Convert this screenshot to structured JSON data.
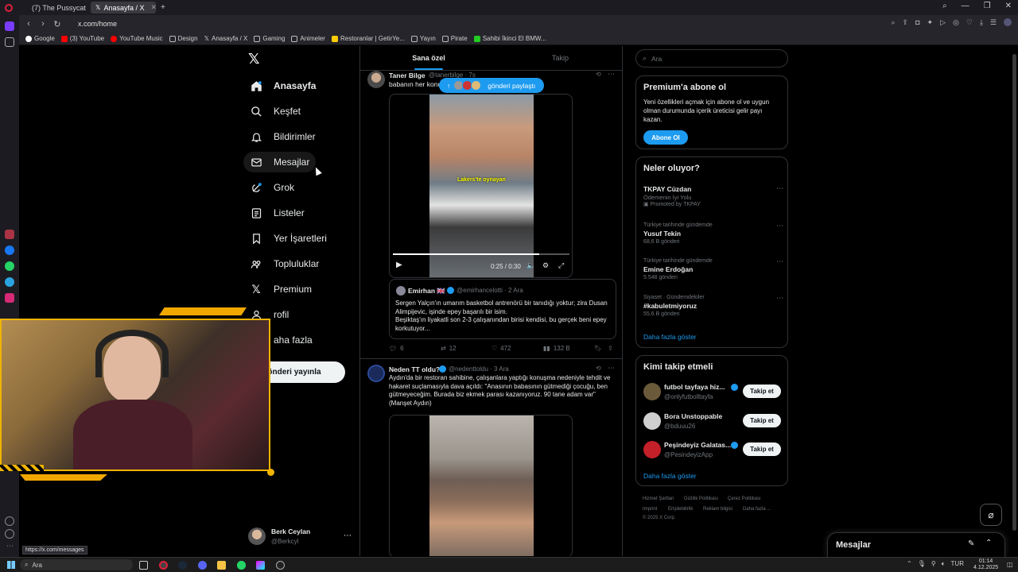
{
  "browser": {
    "tabs": [
      {
        "label": "(7) The Pussycat Dolls - B..."
      },
      {
        "label": "Anasayfa / X"
      }
    ],
    "url": "x.com/home",
    "status_url": "https://x.com/messages",
    "bookmarks": [
      "Google",
      "(3) YouTube",
      "YouTube Music",
      "Design",
      "Anasayfa / X",
      "Gaming",
      "Animeler",
      "Restoranlar | GetirYe...",
      "Yayın",
      "Pirate",
      "Sahibi İkinci El BMW..."
    ]
  },
  "nav": {
    "items": [
      {
        "label": "Anasayfa",
        "icon": "home-icon"
      },
      {
        "label": "Keşfet",
        "icon": "search-icon"
      },
      {
        "label": "Bildirimler",
        "icon": "bell-icon"
      },
      {
        "label": "Mesajlar",
        "icon": "mail-icon"
      },
      {
        "label": "Grok",
        "icon": "grok-icon"
      },
      {
        "label": "Listeler",
        "icon": "list-icon"
      },
      {
        "label": "Yer İşaretleri",
        "icon": "bookmark-icon"
      },
      {
        "label": "Topluluklar",
        "icon": "communities-icon"
      },
      {
        "label": "Premium",
        "icon": "x-logo-icon"
      },
      {
        "label": "rofil",
        "icon": "profile-icon"
      },
      {
        "label": "aha fazla",
        "icon": "more-icon"
      }
    ],
    "post_button": "önderi yayınla",
    "account": {
      "name": "Berk Ceylan",
      "handle": "@Berkcyl"
    }
  },
  "timeline": {
    "tabs": [
      "Sana özel",
      "Takip"
    ],
    "new_posts_pill": "gönderi paylaştı",
    "post1": {
      "name": "Taner Bilge",
      "handle": "@tanerbilge · 7s",
      "text": "babanın her konu",
      "video_caption": "Lakers'te oynayan",
      "video_time": "0:25 / 0:30",
      "quote": {
        "name": "Emirhan 🇬🇧",
        "handle": "@emirhancelotti · 2 Ara",
        "text": "Sergen Yalçın'ın umarım basketbol antrenörü bir tanıdığı yoktur; zira Dusan Alimpijevic, işinde epey başarılı bir isim.\nBeşiktaş'ın liyakatli son 2-3 çalışanından birisi kendisi, bu gerçek beni epey korkutuyor..."
      },
      "stats": {
        "replies": "6",
        "reposts": "12",
        "likes": "472",
        "views": "132 B"
      }
    },
    "post2": {
      "name": "Neden TT oldu?",
      "handle": "@nedenttoldu · 3 Ara",
      "text": "Aydın'da bir restoran sahibine, çalışanlara yaptığı konuşma nedeniyle tehdit ve hakaret suçlamasıyla dava açıldı: \"Anasının babasının gütmediği çocuğu, ben gütmeyeceğim. Burada biz ekmek parası kazanıyoruz. 90 tane adam var\" (Manşet Aydın)"
    }
  },
  "right": {
    "search_placeholder": "Ara",
    "premium": {
      "title": "Premium'a abone ol",
      "text": "Yeni özellikleri açmak için abone ol ve uygun olman durumunda içerik üreticisi gelir payı kazan.",
      "button": "Abone Ol"
    },
    "trends": {
      "title": "Neler oluyor?",
      "items": [
        {
          "category": "",
          "name": "TKPAY Cüzdan",
          "sub": "Ödemenin İyi Yolu",
          "count": "Promoted by TKPAY"
        },
        {
          "category": "Türkiye tarihinde gündemde",
          "name": "Yusuf Tekin",
          "count": "68,6 B gönderi"
        },
        {
          "category": "Türkiye tarihinde gündemde",
          "name": "Emine Erdoğan",
          "count": "5.548 gönderi"
        },
        {
          "category": "Siyaset · Gündemdekiler",
          "name": "#kabuletmiyoruz",
          "count": "55,6 B gönderi"
        }
      ],
      "more": "Daha fazla göster"
    },
    "who_to_follow": {
      "title": "Kimi takip etmeli",
      "items": [
        {
          "name": "futbol tayfaya hiz...",
          "handle": "@onlyfutbolltayfa",
          "button": "Takip et"
        },
        {
          "name": "Bora Unstoppable",
          "handle": "@bduuu26",
          "button": "Takip et"
        },
        {
          "name": "Peşindeyiz Galatas...",
          "handle": "@PesindeyizApp",
          "button": "Takip et"
        }
      ],
      "more": "Daha fazla göster"
    },
    "footer": [
      "Hizmet Şartları",
      "Gizlilik Politikası",
      "Çerez Politikası",
      "Imprint",
      "Erişilebilirlik",
      "Reklam bilgisi",
      "Daha fazla ...",
      "© 2025 X Corp."
    ]
  },
  "messages_drawer": {
    "label": "Mesajlar"
  },
  "taskbar": {
    "search": "Ara",
    "lang": "TUR",
    "time": "01:14",
    "date": "4.12.2025"
  },
  "colors": {
    "accent": "#1d9bf0",
    "background": "#000000",
    "border": "#2f3336"
  }
}
